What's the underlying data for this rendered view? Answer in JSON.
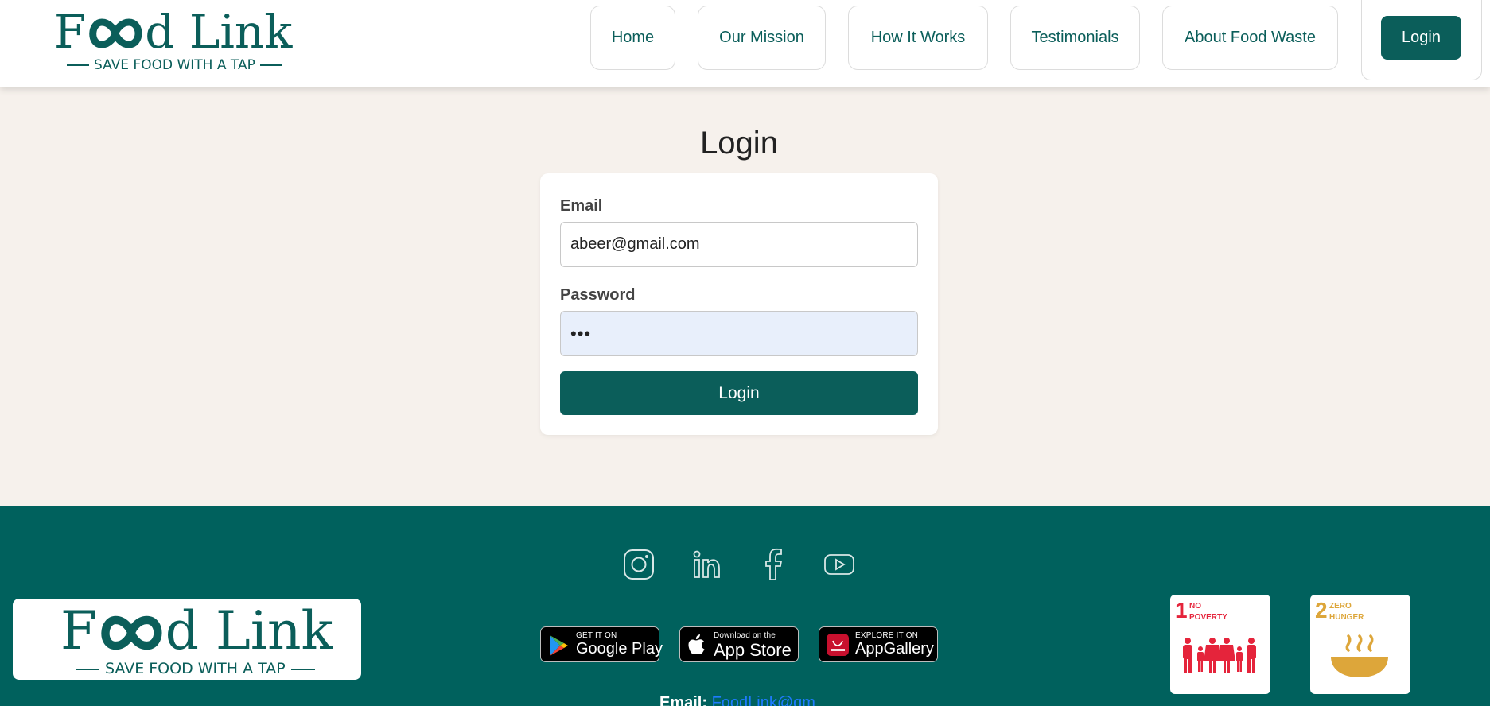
{
  "brand": {
    "name_prefix": "F",
    "name_suffix": "d Link",
    "tagline": "SAVE FOOD WITH A TAP",
    "color": "#0b5e5a"
  },
  "nav": {
    "items": [
      {
        "label": "Home"
      },
      {
        "label": "Our Mission"
      },
      {
        "label": "How It Works"
      },
      {
        "label": "Testimonials"
      },
      {
        "label": "About Food Waste"
      }
    ],
    "login_label": "Login"
  },
  "main": {
    "title": "Login",
    "email_label": "Email",
    "email_value": "abeer@gmail.com",
    "password_label": "Password",
    "password_value": "•••",
    "submit_label": "Login"
  },
  "footer": {
    "social_icons": [
      "instagram-icon",
      "linkedin-icon",
      "facebook-icon",
      "youtube-icon"
    ],
    "stores": [
      {
        "small": "GET IT ON",
        "big": "Google Play"
      },
      {
        "small": "Download on the",
        "big": "App Store"
      },
      {
        "small": "EXPLORE IT ON",
        "big": "AppGallery"
      }
    ],
    "sdgs": [
      {
        "number": "1",
        "text": "NO\nPOVERTY",
        "color": "#e5243b"
      },
      {
        "number": "2",
        "text": "ZERO\nHUNGER",
        "color": "#dda63a"
      }
    ],
    "contact_label": "Email:",
    "contact_value": "FoodLink@gm"
  },
  "colors": {
    "primary": "#0b5e5a",
    "footer_bg": "#00615d",
    "page_bg": "#f6f1ec",
    "link": "#1e7bff"
  }
}
